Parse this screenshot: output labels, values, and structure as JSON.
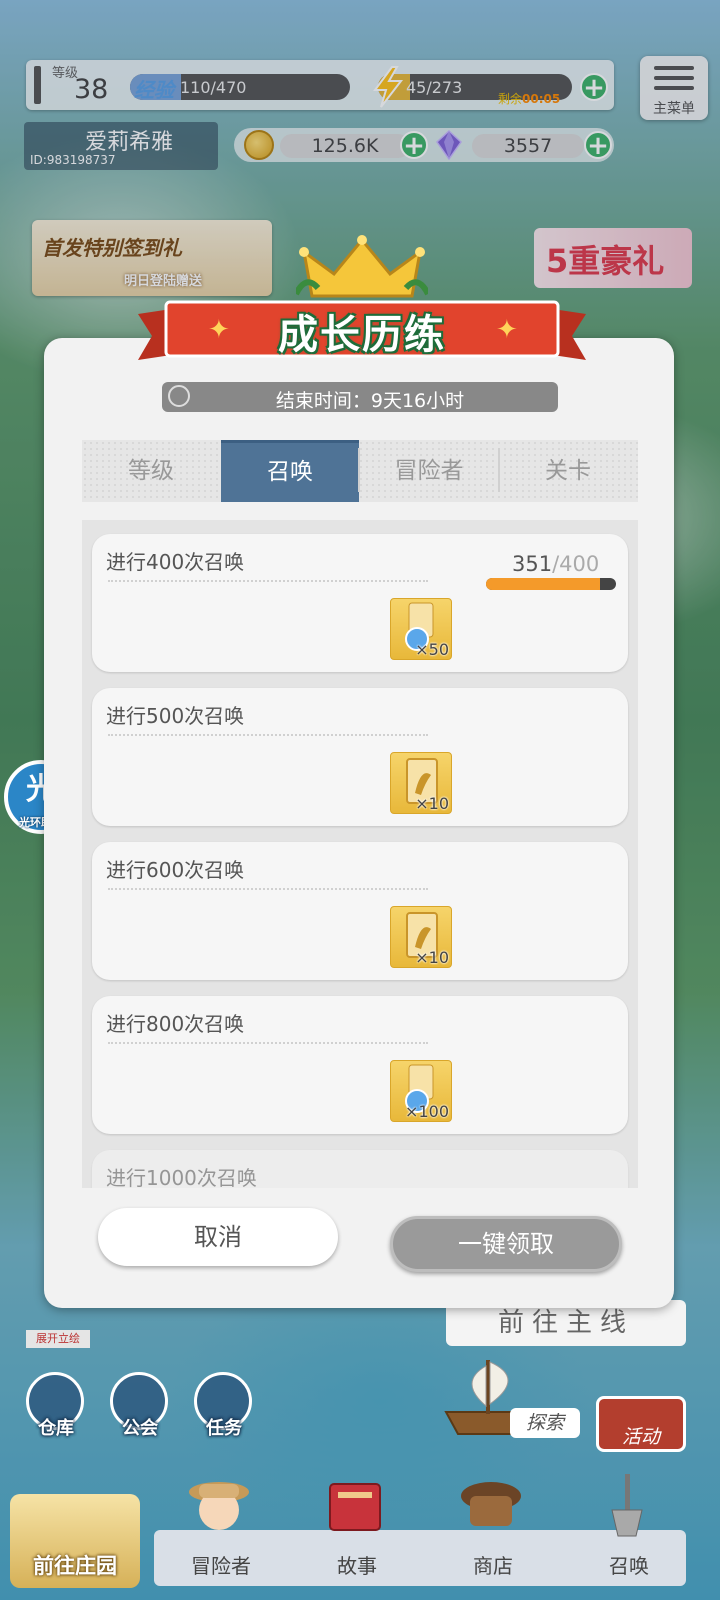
{
  "hud": {
    "level_label": "等级",
    "level": "38",
    "exp_label": "经验",
    "exp_text": "110/470",
    "exp_progress": 0.234,
    "stamina_text": "45/273",
    "stamina_progress": 0.165,
    "stamina_timer_label": "剩余",
    "stamina_timer": "00:05",
    "menu_label": "主菜单",
    "player_name": "爱莉希雅",
    "player_id": "ID:983198737",
    "gold": "125.6K",
    "gems": "3557"
  },
  "banners": {
    "left_title": "首发特别签到礼",
    "left_subtitle": "明日登陆赠送",
    "right_title": "5重豪礼"
  },
  "dialog": {
    "title": "成长历练",
    "timer_text": "结束时间：9天16小时",
    "tabs": [
      {
        "label": "等级"
      },
      {
        "label": "召唤"
      },
      {
        "label": "冒险者"
      },
      {
        "label": "关卡"
      }
    ],
    "active_tab": "召唤",
    "tasks": [
      {
        "title": "进行400次召唤",
        "progress_current": "351",
        "progress_total": "/400",
        "progress": 0.8775,
        "reward_icon": "crystal-ticket-icon",
        "reward_count": "×50"
      },
      {
        "title": "进行500次召唤",
        "reward_icon": "golden-ticket-icon",
        "reward_count": "×10"
      },
      {
        "title": "进行600次召唤",
        "reward_icon": "golden-ticket-icon",
        "reward_count": "×10"
      },
      {
        "title": "进行800次召唤",
        "reward_icon": "crystal-ticket-icon",
        "reward_count": "×100"
      },
      {
        "title": "进行1000次召唤"
      }
    ],
    "cancel_label": "取消",
    "claim_label": "一键领取"
  },
  "helper": {
    "char": "光",
    "label": "光环助手"
  },
  "bottom": {
    "expand_art": "展开立绘",
    "goto_main": "前往主线",
    "warehouse": "仓库",
    "guild": "公会",
    "quest": "任务",
    "explore": "探索",
    "activity": "活动",
    "farm": "前往庄园",
    "nav": [
      {
        "label": "冒险者"
      },
      {
        "label": "故事"
      },
      {
        "label": "商店"
      },
      {
        "label": "召唤"
      }
    ]
  },
  "colors": {
    "tab_active": "#4f7396",
    "progress_fill": "#f49a2a",
    "claim_button": "#9a9a9a",
    "ribbon_red": "#e1442d"
  }
}
